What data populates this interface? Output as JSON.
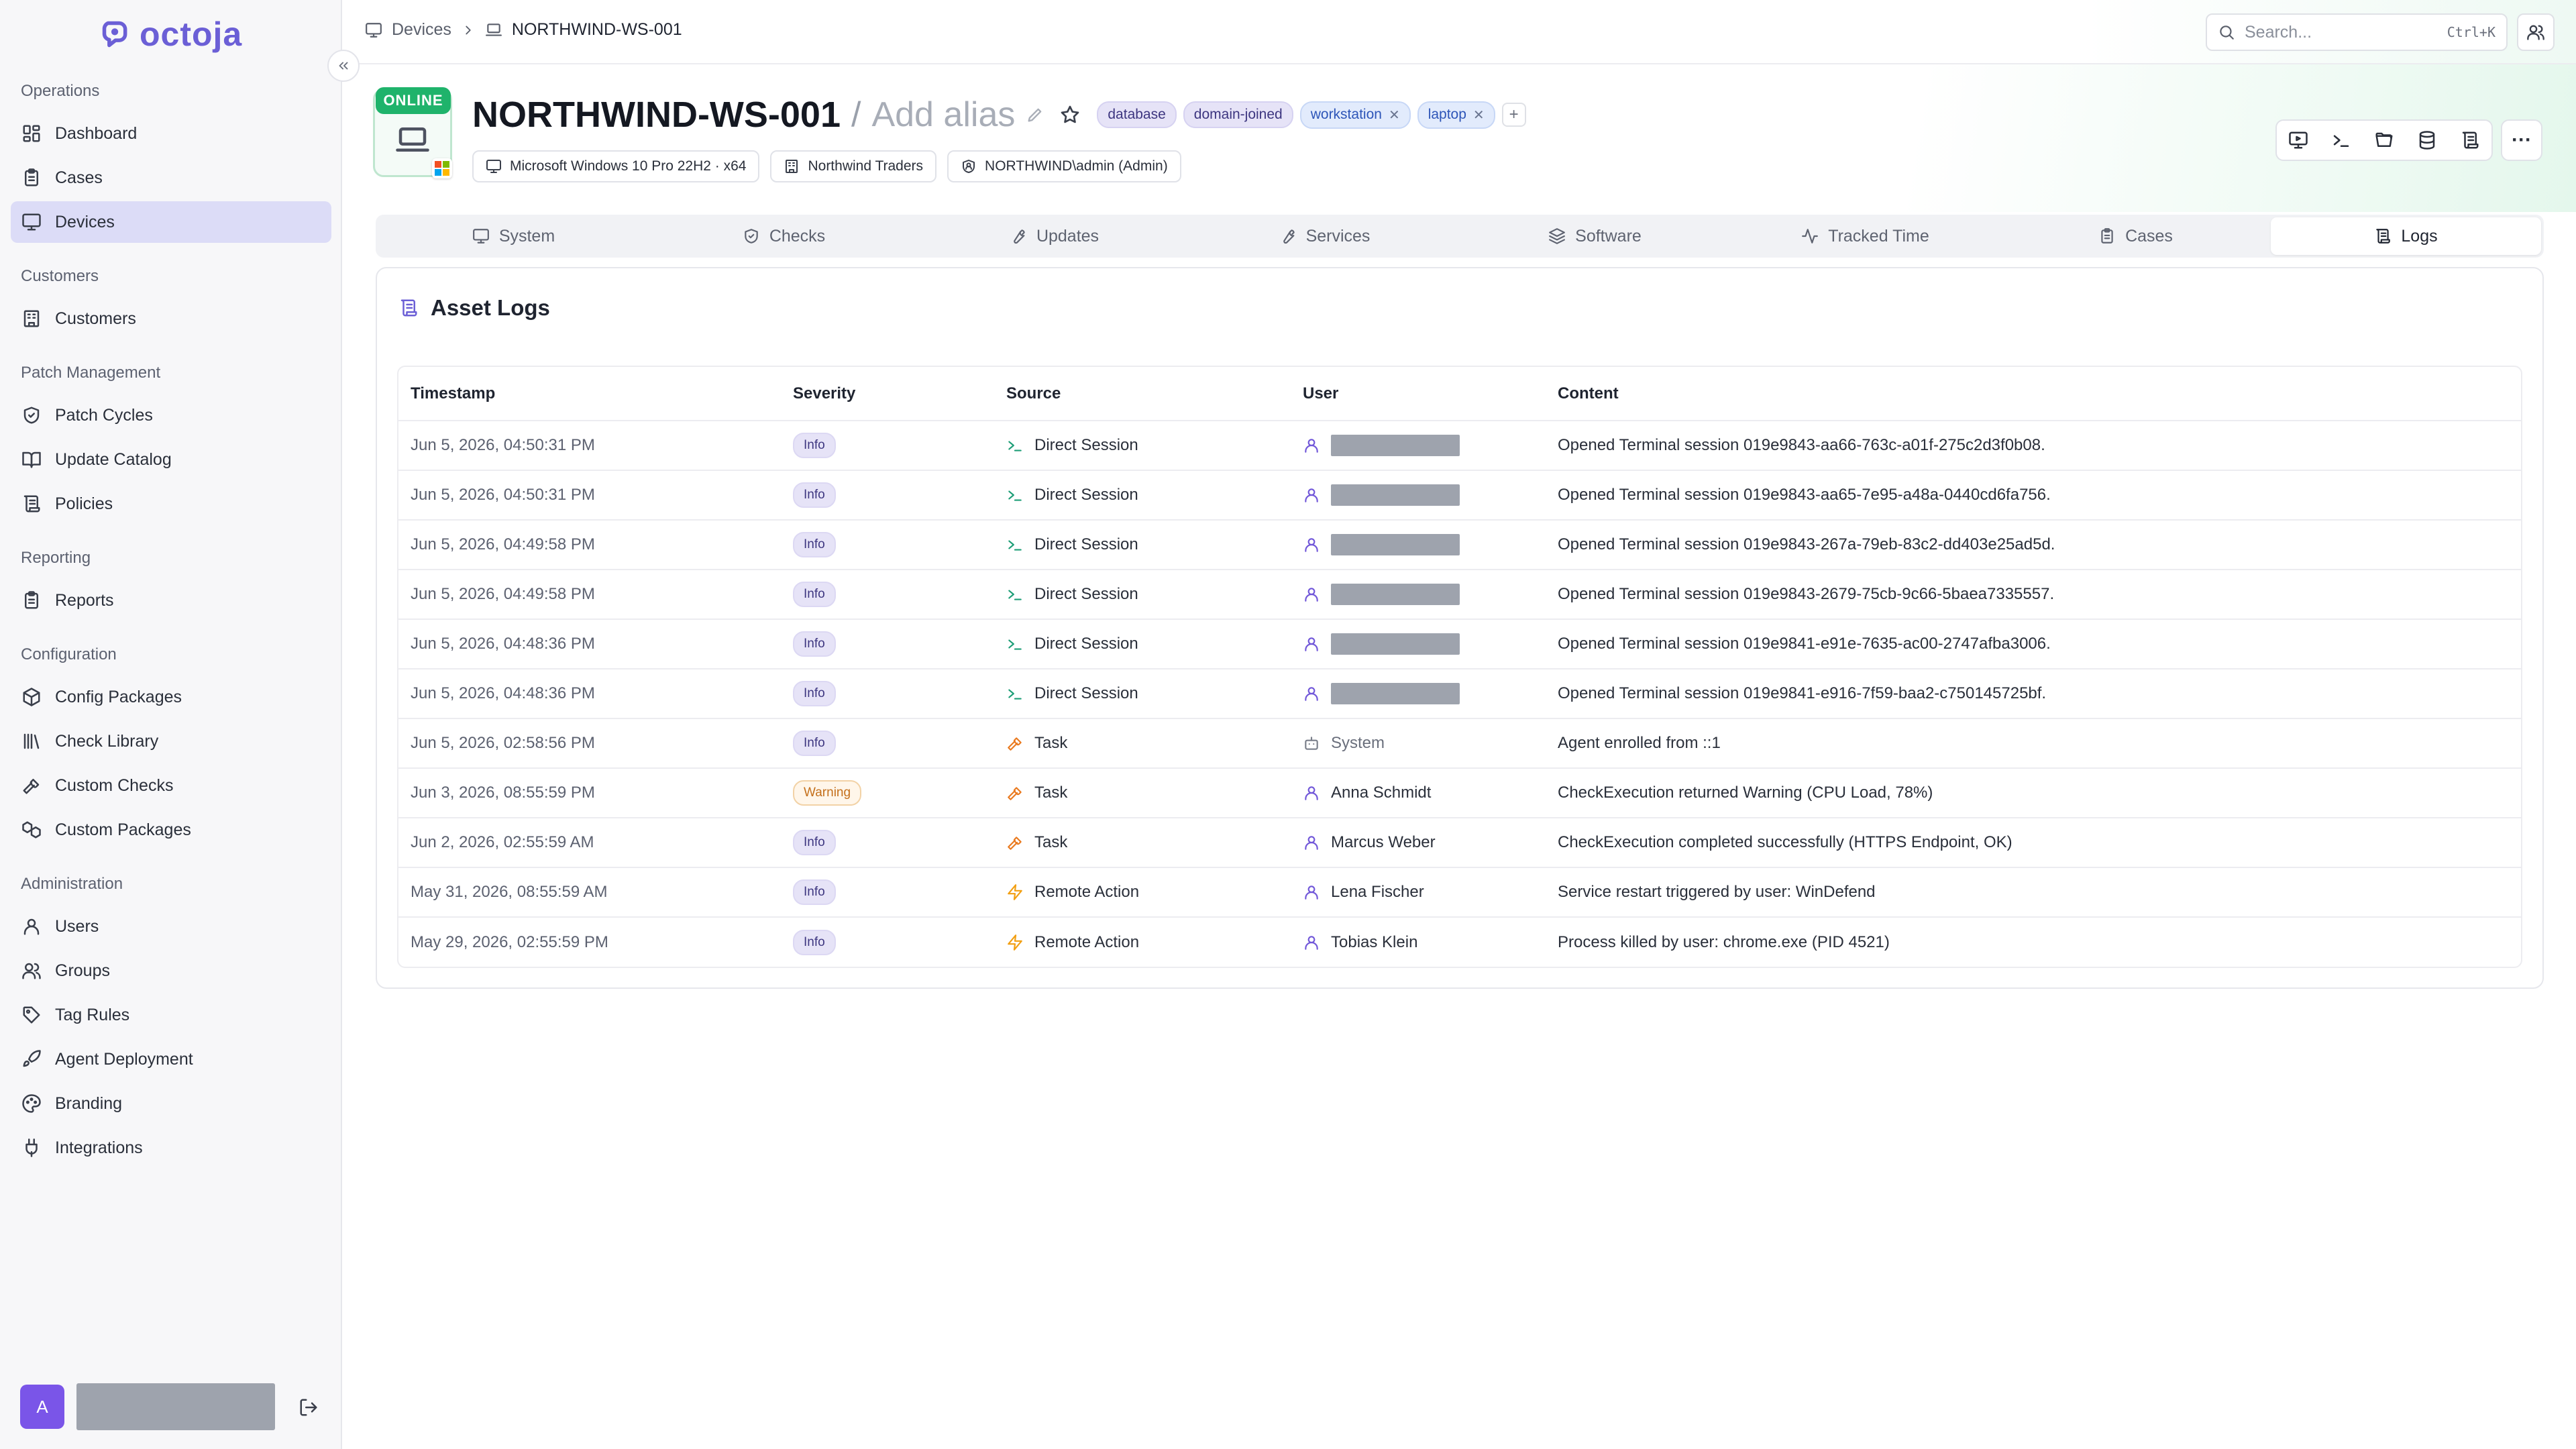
{
  "app": {
    "name": "octoja"
  },
  "sidebar": {
    "sections": [
      {
        "title": "Operations",
        "items": [
          {
            "label": "Dashboard",
            "icon": "dashboard-icon"
          },
          {
            "label": "Cases",
            "icon": "clipboard-icon"
          },
          {
            "label": "Devices",
            "icon": "monitor-icon",
            "active": true
          }
        ]
      },
      {
        "title": "Customers",
        "items": [
          {
            "label": "Customers",
            "icon": "building-icon"
          }
        ]
      },
      {
        "title": "Patch Management",
        "items": [
          {
            "label": "Patch Cycles",
            "icon": "shield-icon"
          },
          {
            "label": "Update Catalog",
            "icon": "book-icon"
          },
          {
            "label": "Policies",
            "icon": "scroll-icon"
          }
        ]
      },
      {
        "title": "Reporting",
        "items": [
          {
            "label": "Reports",
            "icon": "clipboard-icon"
          }
        ]
      },
      {
        "title": "Configuration",
        "items": [
          {
            "label": "Config Packages",
            "icon": "package-icon"
          },
          {
            "label": "Check Library",
            "icon": "library-icon"
          },
          {
            "label": "Custom Checks",
            "icon": "hammer-icon"
          },
          {
            "label": "Custom Packages",
            "icon": "packages-icon"
          }
        ]
      },
      {
        "title": "Administration",
        "items": [
          {
            "label": "Users",
            "icon": "user-icon"
          },
          {
            "label": "Groups",
            "icon": "users-icon"
          },
          {
            "label": "Tag Rules",
            "icon": "tag-icon"
          },
          {
            "label": "Agent Deployment",
            "icon": "rocket-icon"
          },
          {
            "label": "Branding",
            "icon": "palette-icon"
          },
          {
            "label": "Integrations",
            "icon": "plug-icon"
          }
        ]
      }
    ],
    "user": {
      "avatar_letter": "A"
    }
  },
  "topbar": {
    "breadcrumb": [
      "Devices",
      "NORTHWIND-WS-001"
    ],
    "search_placeholder": "Search...",
    "search_shortcut": "Ctrl+K"
  },
  "device": {
    "status": "ONLINE",
    "name": "NORTHWIND-WS-001",
    "alias_separator": "/",
    "alias_placeholder": "Add alias",
    "tags": [
      {
        "label": "database",
        "removable": false
      },
      {
        "label": "domain-joined",
        "removable": false
      },
      {
        "label": "workstation",
        "removable": true
      },
      {
        "label": "laptop",
        "removable": true
      }
    ],
    "add_tag": "+",
    "os": "Microsoft Windows 10 Pro 22H2 · x64",
    "customer": "Northwind Traders",
    "account": "NORTHWIND\\admin (Admin)",
    "more": "···"
  },
  "tabs": [
    {
      "label": "System",
      "icon": "monitor-icon"
    },
    {
      "label": "Checks",
      "icon": "shield-check-icon"
    },
    {
      "label": "Updates",
      "icon": "wrench-icon"
    },
    {
      "label": "Services",
      "icon": "wrench-icon"
    },
    {
      "label": "Software",
      "icon": "layers-icon"
    },
    {
      "label": "Tracked Time",
      "icon": "activity-icon"
    },
    {
      "label": "Cases",
      "icon": "clipboard-icon"
    },
    {
      "label": "Logs",
      "icon": "scroll-icon",
      "active": true
    }
  ],
  "logs": {
    "title": "Asset Logs",
    "columns": [
      "Timestamp",
      "Severity",
      "Source",
      "User",
      "Content"
    ],
    "rows": [
      {
        "timestamp": "Jun 5, 2026, 04:50:31 PM",
        "severity": "Info",
        "source": "Direct Session",
        "source_kind": "session",
        "user": "",
        "user_kind": "redacted",
        "content": "Opened Terminal session 019e9843-aa66-763c-a01f-275c2d3f0b08."
      },
      {
        "timestamp": "Jun 5, 2026, 04:50:31 PM",
        "severity": "Info",
        "source": "Direct Session",
        "source_kind": "session",
        "user": "",
        "user_kind": "redacted",
        "content": "Opened Terminal session 019e9843-aa65-7e95-a48a-0440cd6fa756."
      },
      {
        "timestamp": "Jun 5, 2026, 04:49:58 PM",
        "severity": "Info",
        "source": "Direct Session",
        "source_kind": "session",
        "user": "",
        "user_kind": "redacted",
        "content": "Opened Terminal session 019e9843-267a-79eb-83c2-dd403e25ad5d."
      },
      {
        "timestamp": "Jun 5, 2026, 04:49:58 PM",
        "severity": "Info",
        "source": "Direct Session",
        "source_kind": "session",
        "user": "",
        "user_kind": "redacted",
        "content": "Opened Terminal session 019e9843-2679-75cb-9c66-5baea7335557."
      },
      {
        "timestamp": "Jun 5, 2026, 04:48:36 PM",
        "severity": "Info",
        "source": "Direct Session",
        "source_kind": "session",
        "user": "",
        "user_kind": "redacted",
        "content": "Opened Terminal session 019e9841-e91e-7635-ac00-2747afba3006."
      },
      {
        "timestamp": "Jun 5, 2026, 04:48:36 PM",
        "severity": "Info",
        "source": "Direct Session",
        "source_kind": "session",
        "user": "",
        "user_kind": "redacted",
        "content": "Opened Terminal session 019e9841-e916-7f59-baa2-c750145725bf."
      },
      {
        "timestamp": "Jun 5, 2026, 02:58:56 PM",
        "severity": "Info",
        "source": "Task",
        "source_kind": "task",
        "user": "System",
        "user_kind": "system",
        "content": "Agent enrolled from ::1"
      },
      {
        "timestamp": "Jun 3, 2026, 08:55:59 PM",
        "severity": "Warning",
        "source": "Task",
        "source_kind": "task",
        "user": "Anna Schmidt",
        "user_kind": "person",
        "content": "CheckExecution returned Warning (CPU Load, 78%)"
      },
      {
        "timestamp": "Jun 2, 2026, 02:55:59 AM",
        "severity": "Info",
        "source": "Task",
        "source_kind": "task",
        "user": "Marcus Weber",
        "user_kind": "person",
        "content": "CheckExecution completed successfully (HTTPS Endpoint, OK)"
      },
      {
        "timestamp": "May 31, 2026, 08:55:59 AM",
        "severity": "Info",
        "source": "Remote Action",
        "source_kind": "remote",
        "user": "Lena Fischer",
        "user_kind": "person",
        "content": "Service restart triggered by user: WinDefend"
      },
      {
        "timestamp": "May 29, 2026, 02:55:59 PM",
        "severity": "Info",
        "source": "Remote Action",
        "source_kind": "remote",
        "user": "Tobias Klein",
        "user_kind": "person",
        "content": "Process killed by user: chrome.exe (PID 4521)"
      }
    ]
  },
  "colors": {
    "accent": "#6b5fd6",
    "online": "#1fb36b",
    "warning": "#c4701c",
    "active_nav": "#dcdcf7"
  }
}
